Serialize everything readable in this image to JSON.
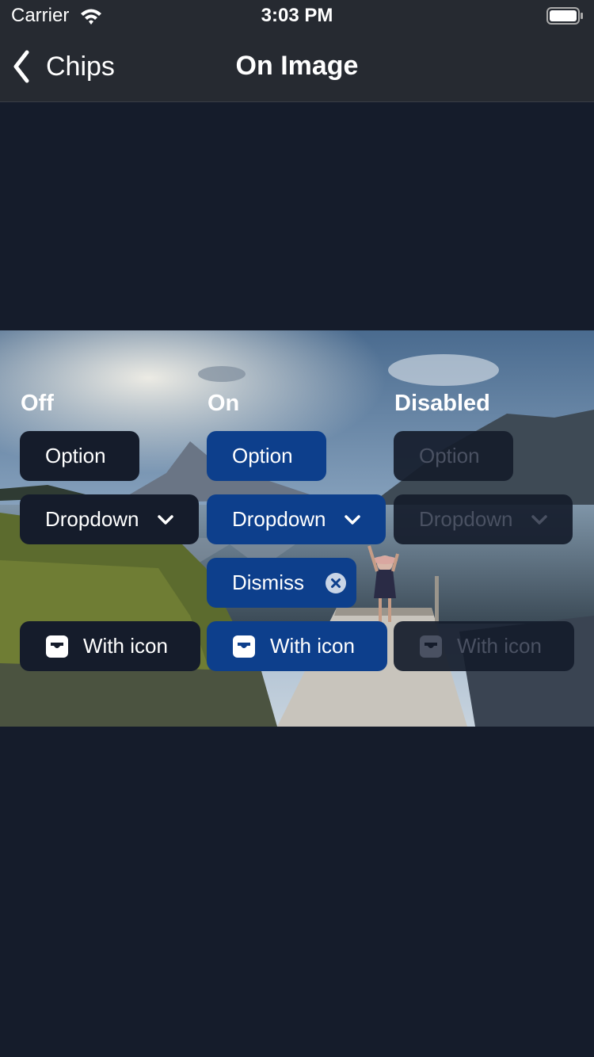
{
  "status_bar": {
    "carrier": "Carrier",
    "time": "3:03 PM",
    "wifi_icon": "wifi-icon",
    "battery_icon": "battery-icon"
  },
  "nav": {
    "back_label": "Chips",
    "back_icon": "chevron-left-icon",
    "title": "On Image"
  },
  "columns": {
    "off": {
      "label": "Off",
      "option": "Option",
      "dropdown": "Dropdown",
      "with_icon": "With icon"
    },
    "on": {
      "label": "On",
      "option": "Option",
      "dropdown": "Dropdown",
      "dismiss": "Dismiss",
      "with_icon": "With icon"
    },
    "disabled": {
      "label": "Disabled",
      "option": "Option",
      "dropdown": "Dropdown",
      "with_icon": "With icon"
    }
  },
  "icons": {
    "dropdown": "chevron-down-icon",
    "dismiss": "close-circle-icon",
    "with_icon": "inbox-icon"
  },
  "colors": {
    "background": "#151c2b",
    "bar": "#262a31",
    "chip_off": "#151c2b",
    "chip_on": "#0d3f8c",
    "chip_disabled_text": "#4a5162"
  }
}
